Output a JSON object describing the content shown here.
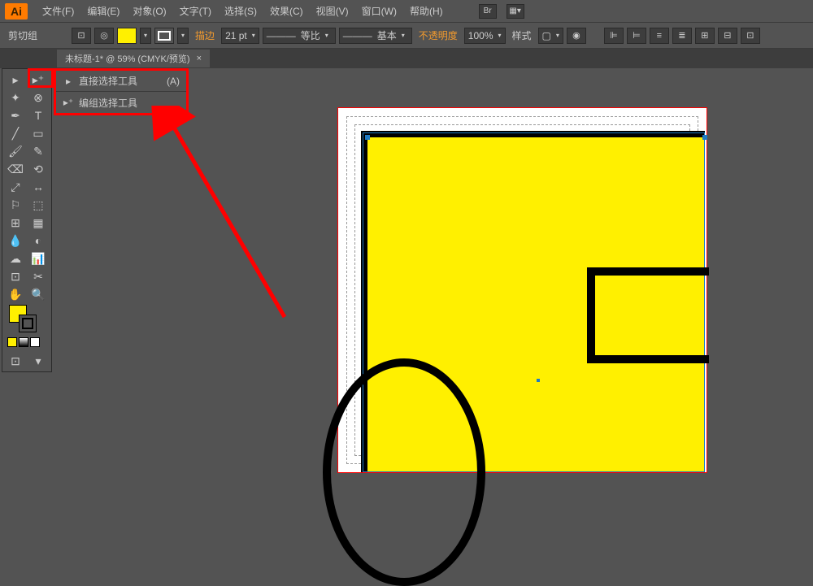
{
  "app": {
    "logo": "Ai"
  },
  "menu": {
    "file": "文件(F)",
    "edit": "编辑(E)",
    "object": "对象(O)",
    "type": "文字(T)",
    "select": "选择(S)",
    "effect": "效果(C)",
    "view": "视图(V)",
    "window": "窗口(W)",
    "help": "帮助(H)",
    "br": "Br"
  },
  "control": {
    "mode_label": "剪切组",
    "stroke_label": "描边",
    "stroke_value": "21 pt",
    "scale_label": "等比",
    "basic_label": "基本",
    "opacity_label": "不透明度",
    "opacity_value": "100%",
    "style_label": "样式"
  },
  "tab": {
    "title": "未标题-1* @ 59% (CMYK/预览)",
    "close": "×"
  },
  "flyout": {
    "item1_icon": "▸",
    "item1_label": "直接选择工具",
    "item1_shortcut": "(A)",
    "item2_icon": "▸⁺",
    "item2_label": "编组选择工具"
  },
  "tools": {
    "selection": "▸",
    "direct": "▸⁺",
    "wand": "✦",
    "lasso": "⊗",
    "pen": "✒",
    "type": "T",
    "line": "╱",
    "rect": "▭",
    "brush": "🖌",
    "pencil": "✎",
    "eraser": "⌫",
    "rotate": "⟲",
    "scale": "⤢",
    "width": "↔",
    "warp": "⚐",
    "shape": "⬚",
    "mesh": "⊞",
    "gradient": "▦",
    "eyedrop": "💧",
    "blend": "◐",
    "symbol": "☁",
    "graph": "📊",
    "artboard": "⊡",
    "slice": "✂",
    "hand": "✋",
    "zoom": "🔍"
  },
  "colors": {
    "yellow": "#fff000",
    "accent_red": "#ff0000",
    "stroke_orange": "#f29a2e"
  }
}
